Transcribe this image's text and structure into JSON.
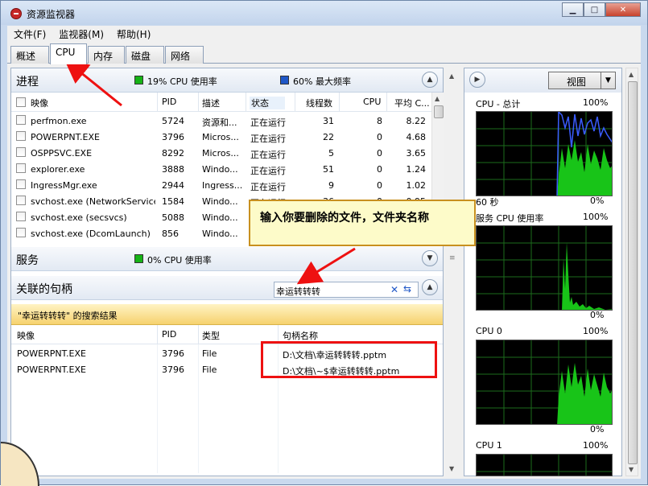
{
  "window": {
    "title": "资源监视器",
    "btn_min": "▁",
    "btn_max": "□",
    "btn_close": "✕"
  },
  "menu": [
    "文件(F)",
    "监视器(M)",
    "帮助(H)"
  ],
  "tabs": [
    "概述",
    "CPU",
    "内存",
    "磁盘",
    "网络"
  ],
  "processes": {
    "title": "进程",
    "cpu_usage": "19% CPU 使用率",
    "max_freq": "60% 最大频率",
    "columns": [
      "映像",
      "PID",
      "描述",
      "状态",
      "线程数",
      "CPU",
      "平均 C..."
    ],
    "rows": [
      {
        "image": "perfmon.exe",
        "pid": "5724",
        "desc": "资源和...",
        "status": "正在运行",
        "threads": "31",
        "cpu": "8",
        "avg": "8.22"
      },
      {
        "image": "POWERPNT.EXE",
        "pid": "3796",
        "desc": "Micros...",
        "status": "正在运行",
        "threads": "22",
        "cpu": "0",
        "avg": "4.68"
      },
      {
        "image": "OSPPSVC.EXE",
        "pid": "8292",
        "desc": "Micros...",
        "status": "正在运行",
        "threads": "5",
        "cpu": "0",
        "avg": "3.65"
      },
      {
        "image": "explorer.exe",
        "pid": "3888",
        "desc": "Windo...",
        "status": "正在运行",
        "threads": "51",
        "cpu": "0",
        "avg": "1.24"
      },
      {
        "image": "IngressMgr.exe",
        "pid": "2944",
        "desc": "Ingress...",
        "status": "正在运行",
        "threads": "9",
        "cpu": "0",
        "avg": "1.02"
      },
      {
        "image": "svchost.exe (NetworkService)",
        "pid": "1584",
        "desc": "Windo...",
        "status": "正在运行",
        "threads": "36",
        "cpu": "0",
        "avg": "0.95"
      },
      {
        "image": "svchost.exe (secsvcs)",
        "pid": "5088",
        "desc": "Windo...",
        "status": "",
        "threads": "",
        "cpu": "",
        "avg": ""
      },
      {
        "image": "svchost.exe (DcomLaunch)",
        "pid": "856",
        "desc": "Windo...",
        "status": "",
        "threads": "",
        "cpu": "",
        "avg": ""
      }
    ]
  },
  "services": {
    "title": "服务",
    "cpu_usage": "0% CPU 使用率"
  },
  "handles": {
    "title": "关联的句柄",
    "search_value": "幸运转转转",
    "results_label": "\"幸运转转转\" 的搜索结果",
    "columns": [
      "映像",
      "PID",
      "类型",
      "句柄名称"
    ],
    "rows": [
      {
        "image": "POWERPNT.EXE",
        "pid": "3796",
        "type": "File",
        "name": "D:\\文档\\幸运转转转.pptm"
      },
      {
        "image": "POWERPNT.EXE",
        "pid": "3796",
        "type": "File",
        "name": "D:\\文档\\~$幸运转转转.pptm"
      }
    ]
  },
  "right_panel": {
    "view_label": "视图",
    "graphs": [
      {
        "label": "CPU - 总计",
        "max": "100%",
        "time": "60 秒",
        "min": "0%"
      },
      {
        "label": "服务 CPU 使用率",
        "max": "100%",
        "min": "0%"
      },
      {
        "label": "CPU 0",
        "max": "100%",
        "min": "0%"
      },
      {
        "label": "CPU 1",
        "max": "100%"
      }
    ]
  },
  "callout": "输入你要删除的文件，文件夹名称",
  "colors": {
    "accent_red": "#e11111",
    "graph_green": "#18c418",
    "graph_blue": "#3a5cff"
  }
}
